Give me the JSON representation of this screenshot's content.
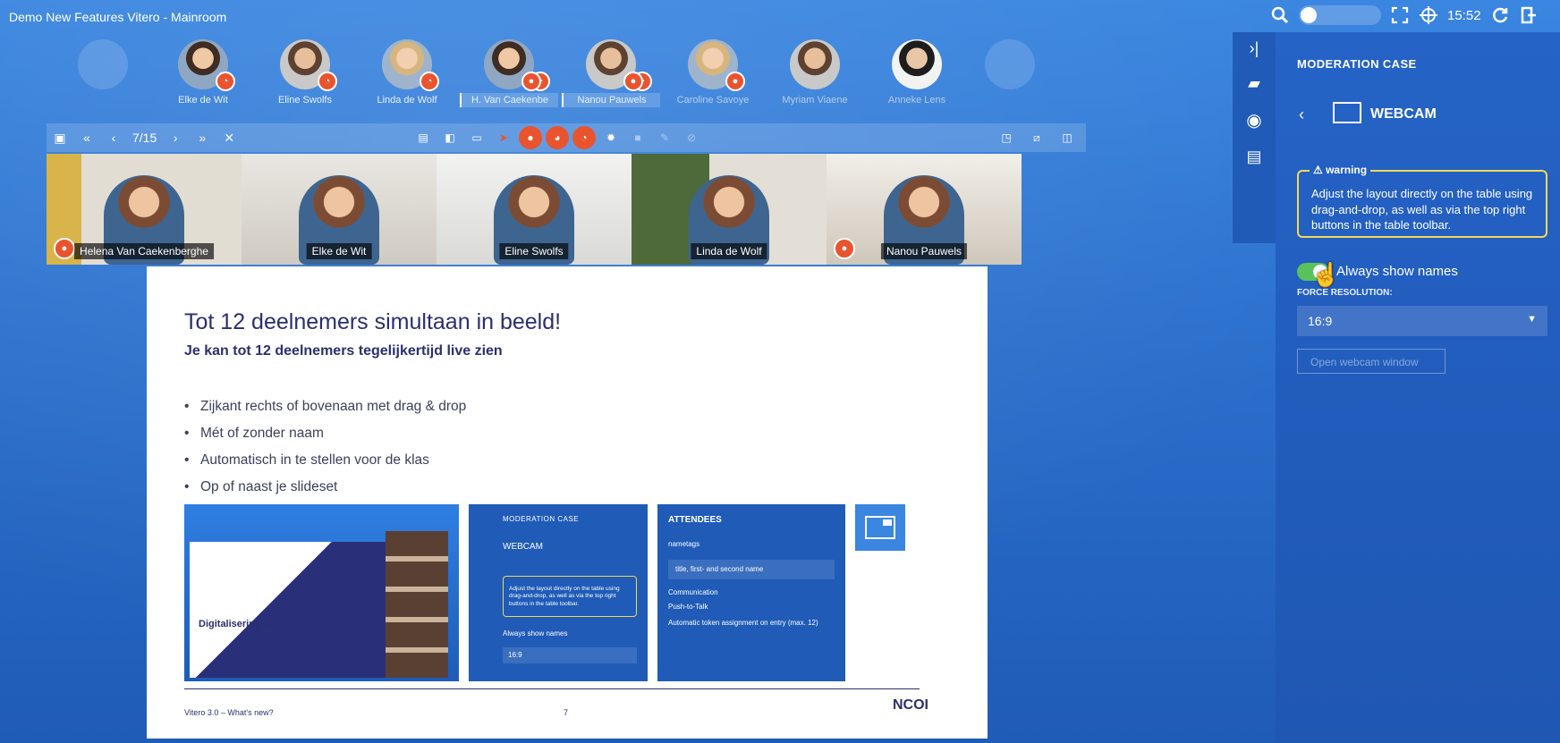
{
  "window": {
    "title": "Demo New Features Vitero - Mainroom"
  },
  "topbar": {
    "clock": "15:52",
    "icons": [
      "search-icon",
      "slider-toggle",
      "fullscreen-icon",
      "target-icon",
      "refresh-icon",
      "exit-icon"
    ]
  },
  "participants": [
    {
      "name": "Elke de Wit",
      "style": "hair1"
    },
    {
      "name": "Eline Swolfs",
      "style": "hair3"
    },
    {
      "name": "Linda de Wolf",
      "style": "hair2"
    },
    {
      "name": "H. Van Caekenbe",
      "style": "hair1"
    },
    {
      "name": "Nanou Pauwels",
      "style": "hair3"
    },
    {
      "name": "Caroline Savoye",
      "style": "hair2"
    },
    {
      "name": "Myriam Viaene",
      "style": "hair3"
    },
    {
      "name": "Anneke Lens",
      "style": "hair4"
    }
  ],
  "slidebar": {
    "page": "7/15"
  },
  "webcams": [
    {
      "name": "Helena Van Caekenberghe"
    },
    {
      "name": "Elke de Wit"
    },
    {
      "name": "Eline Swolfs"
    },
    {
      "name": "Linda de Wolf"
    },
    {
      "name": "Nanou Pauwels"
    }
  ],
  "slide": {
    "title": "Tot 12 deelnemers simultaan in beeld!",
    "subtitle": "Je kan tot 12 deelnemers tegelijkertijd live zien",
    "bullets": [
      "Zijkant rechts of bovenaan met drag & drop",
      "Mét of zonder naam",
      "Automatisch in te stellen voor de klas",
      "Op of naast je slideset"
    ],
    "thumb1_title": "Digitalisering 2.0",
    "thumb2": {
      "header": "MODERATION CASE",
      "webcam": "WEBCAM",
      "warning": "Adjust the layout directly on the table using drag-and-drop, as well as via the top right buttons in the table toolbar.",
      "names": "Always show names",
      "resolution": "16:9"
    },
    "thumb3": {
      "header": "ATTENDEES",
      "nametags": "nametags",
      "nametag_value": "title, first- and second name",
      "communication": "Communication",
      "ptt": "Push-to-Talk",
      "token": "Automatic token assignment on entry (max. 12)"
    },
    "footer": "Vitero 3.0 – What's new?",
    "page_number": "7",
    "logo": "NCOI"
  },
  "panel": {
    "header": "MODERATION CASE",
    "section": "WEBCAM",
    "warning_label": "warning",
    "warning_text": "Adjust the layout directly on the table using drag-and-drop, as well as via the top right buttons in the table toolbar.",
    "show_names_label": "Always show names",
    "show_names_on": true,
    "force_resolution_label": "FORCE RESOLUTION:",
    "resolution_value": "16:9",
    "open_webcam_label": "Open webcam window"
  },
  "colors": {
    "accent_red": "#e9542f",
    "panel_blue": "#1f57b3",
    "warning_yellow": "#f5d75a",
    "toggle_green": "#59c25a"
  }
}
